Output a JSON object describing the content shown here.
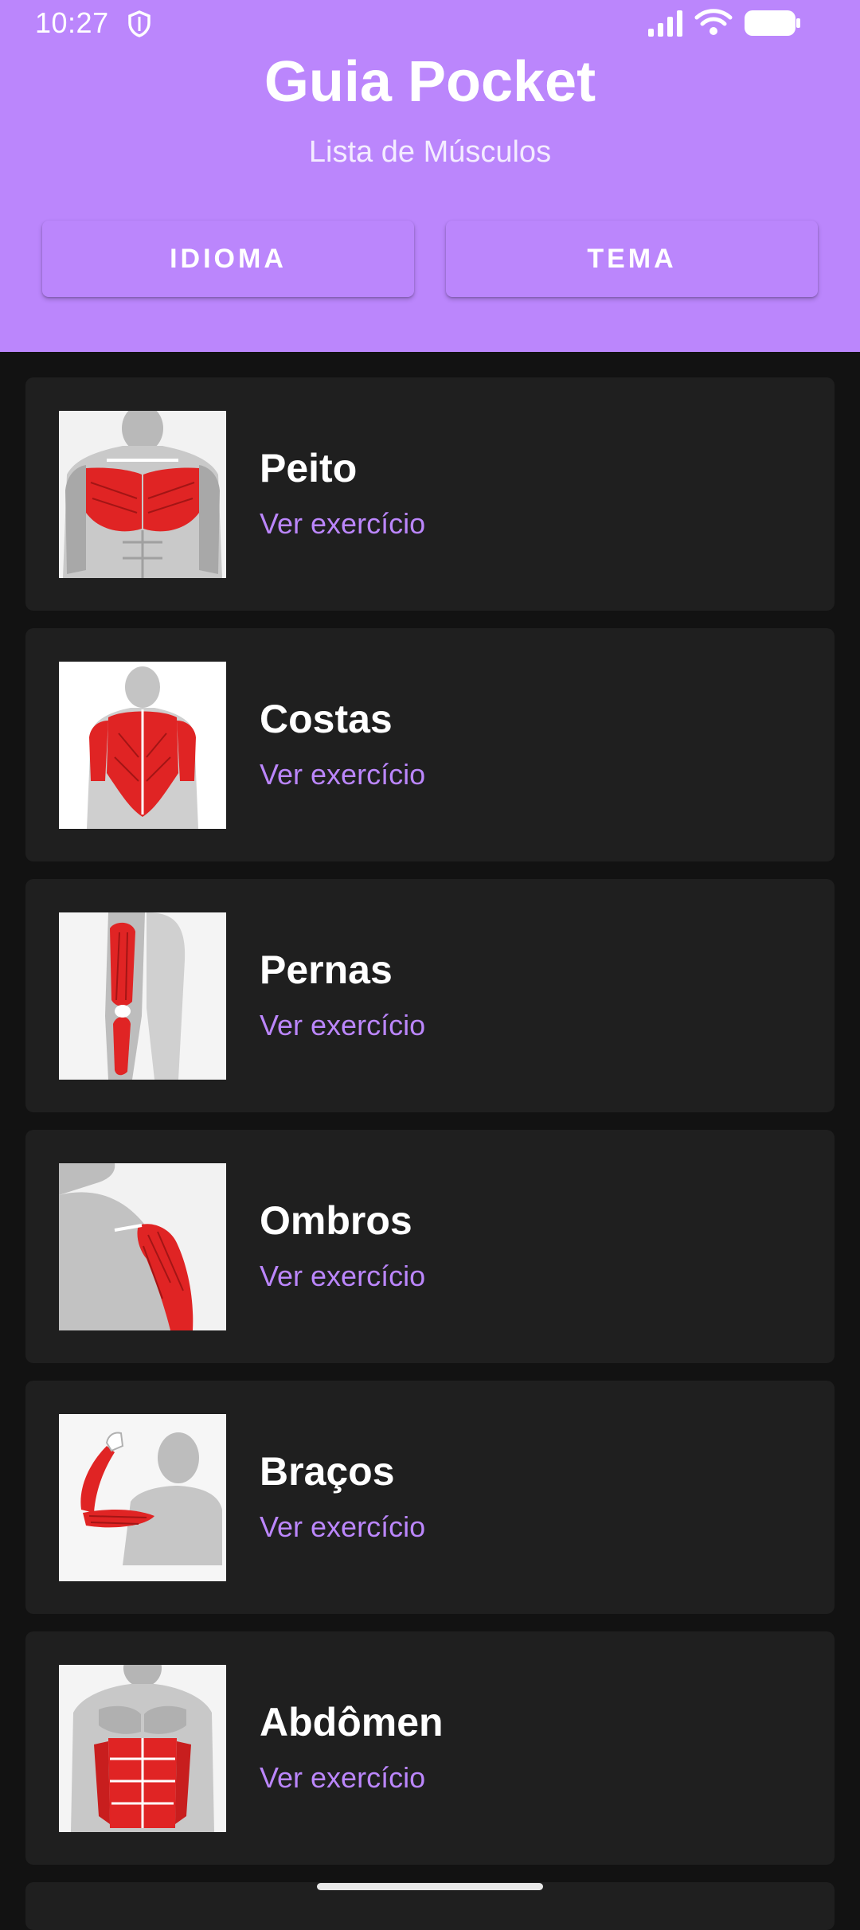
{
  "status_bar": {
    "time": "10:27",
    "icons": [
      "shield-icon",
      "signal-icon",
      "wifi-icon",
      "battery-icon"
    ]
  },
  "header": {
    "title": "Guia Pocket",
    "subtitle": "Lista de Músculos",
    "buttons": {
      "language": "IDIOMA",
      "theme": "TEMA"
    }
  },
  "muscles": [
    {
      "name": "Peito",
      "link": "Ver exercício",
      "image": "chest-muscle-image"
    },
    {
      "name": "Costas",
      "link": "Ver exercício",
      "image": "back-muscle-image"
    },
    {
      "name": "Pernas",
      "link": "Ver exercício",
      "image": "legs-muscle-image"
    },
    {
      "name": "Ombros",
      "link": "Ver exercício",
      "image": "shoulders-muscle-image"
    },
    {
      "name": "Braços",
      "link": "Ver exercício",
      "image": "arms-muscle-image"
    },
    {
      "name": "Abdômen",
      "link": "Ver exercício",
      "image": "abs-muscle-image"
    }
  ],
  "colors": {
    "primary": "#bb86fc",
    "background": "#121212",
    "card": "#1f1f1f",
    "muscle_red": "#e02424",
    "body_gray": "#b9b9b9"
  }
}
